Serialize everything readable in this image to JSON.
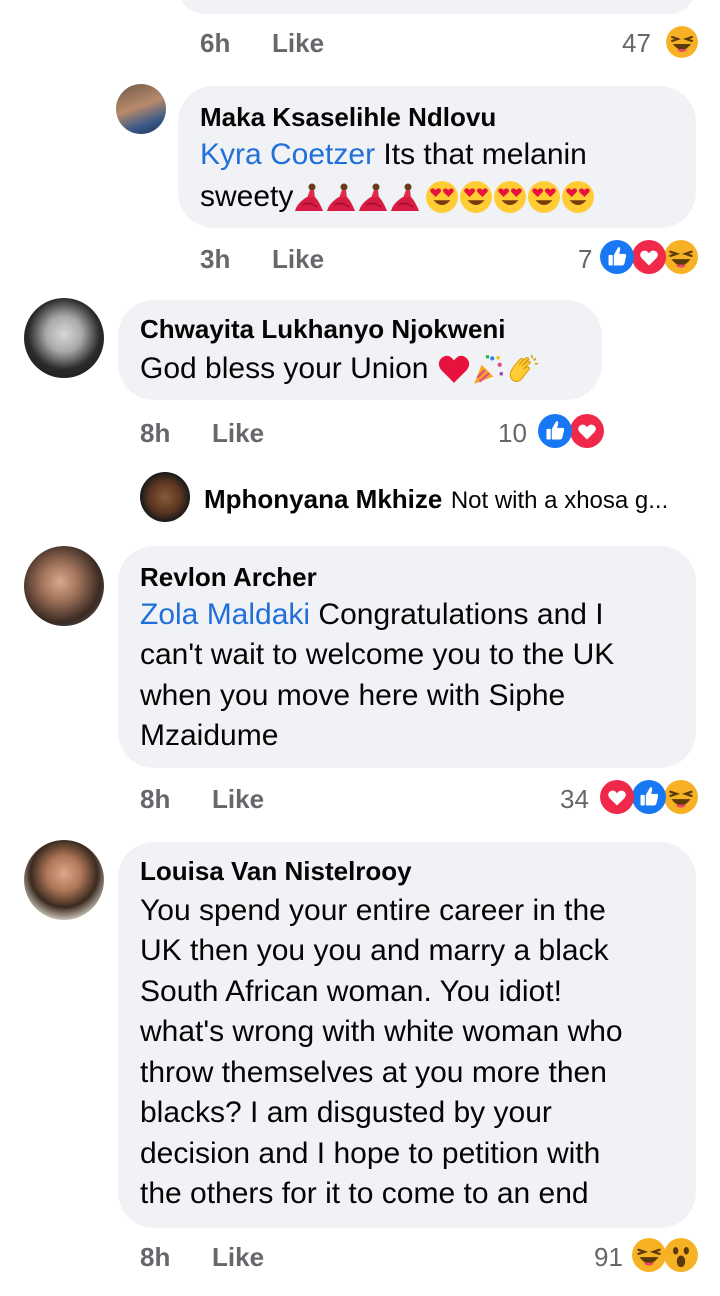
{
  "comments": [
    {
      "time": "6h",
      "like": "Like",
      "count": "47"
    },
    {
      "name": "Maka Ksaselihle Ndlovu",
      "mention": "Kyra Coetzer",
      "text_1": " Its that melanin",
      "text_2": "sweety",
      "time": "3h",
      "like": "Like",
      "count": "7"
    },
    {
      "name": "Chwayita Lukhanyo Njokweni",
      "text_1": "God bless your Union",
      "time": "8h",
      "like": "Like",
      "count": "10"
    },
    {
      "name": "Mphonyana Mkhize",
      "text_1": "Not with a xhosa g..."
    },
    {
      "name": "Revlon Archer",
      "mention": "Zola Maldaki",
      "text_1": " Congratulations and I",
      "text_2": "can't wait to welcome you to the UK",
      "text_3": "when you move here with Siphe",
      "text_4": "Mzaidume",
      "time": "8h",
      "like": "Like",
      "count": "34"
    },
    {
      "name": "Louisa Van Nistelrooy",
      "text_1": "You spend your entire career in the",
      "text_2": "UK then you you and marry a black",
      "text_3": "South African woman. You idiot!",
      "text_4": "what's wrong with white woman who",
      "text_5": "throw themselves at you more then",
      "text_6": "blacks? I am disgusted by your",
      "text_7": "decision and I hope to petition with",
      "text_8": "the others for it to come to an end",
      "time": "8h",
      "like": "Like",
      "count": "91"
    }
  ],
  "icons": [
    "haha-reaction",
    "like-reaction",
    "love-reaction",
    "wow-reaction",
    "dancer-emoji",
    "heart-eyes-emoji",
    "red-heart-emoji",
    "party-popper-emoji",
    "clapping-hands-emoji"
  ]
}
